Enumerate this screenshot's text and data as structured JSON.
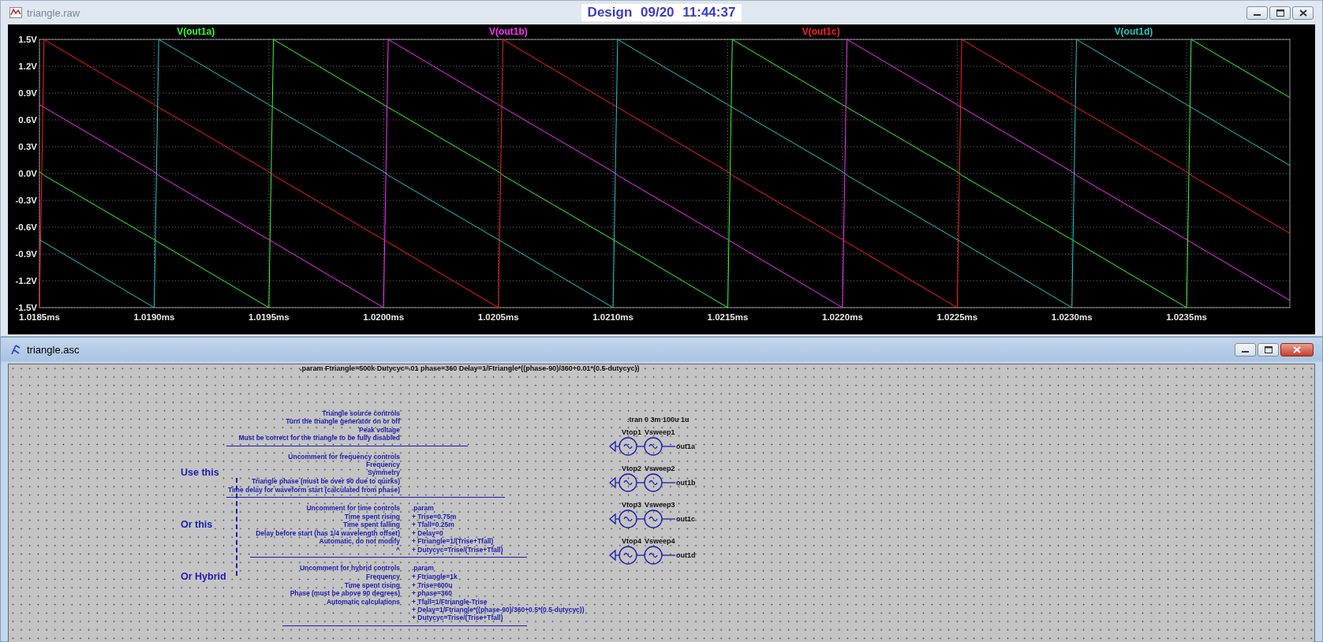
{
  "waveform_window": {
    "title": "triangle.raw",
    "plot_title": "Design 09/20 11:44:37",
    "chart_data": {
      "type": "line",
      "x": [
        1.0185,
        1.01852,
        1.019,
        1.01902,
        1.0195,
        1.01952,
        1.02,
        1.02002,
        1.0205,
        1.02052,
        1.021,
        1.02102,
        1.0215,
        1.02152,
        1.022,
        1.02202,
        1.0225,
        1.02252,
        1.023,
        1.02302,
        1.0235,
        1.02352,
        1.02395
      ],
      "series": [
        {
          "name": "V(out1a)",
          "color": "#33ff33",
          "values": [
            0.02,
            -0.02,
            -0.74,
            -0.77,
            -1.5,
            1.5,
            0.77,
            0.74,
            0.02,
            -0.02,
            -0.74,
            -0.77,
            -1.5,
            1.5,
            0.77,
            0.74,
            0.02,
            -0.02,
            -0.74,
            -0.77,
            -1.5,
            1.5,
            0.85
          ]
        },
        {
          "name": "V(out1b)",
          "color": "#ff33ff",
          "values": [
            0.77,
            0.74,
            0.02,
            -0.02,
            -0.74,
            -0.77,
            -1.5,
            1.5,
            0.77,
            0.74,
            0.02,
            -0.02,
            -0.74,
            -0.77,
            -1.5,
            1.5,
            0.77,
            0.74,
            0.02,
            -0.02,
            -0.74,
            -0.77,
            -1.42
          ]
        },
        {
          "name": "V(out1c)",
          "color": "#ff2020",
          "values": [
            -1.5,
            1.5,
            0.77,
            0.74,
            0.02,
            -0.02,
            -0.74,
            -0.77,
            -1.5,
            1.5,
            0.77,
            0.74,
            0.02,
            -0.02,
            -0.74,
            -0.77,
            -1.5,
            1.5,
            0.77,
            0.74,
            0.02,
            -0.02,
            -0.67
          ]
        },
        {
          "name": "V(out1d)",
          "color": "#20c8c8",
          "values": [
            -0.74,
            -0.77,
            -1.5,
            1.5,
            0.77,
            0.74,
            0.02,
            -0.02,
            -0.74,
            -0.77,
            -1.5,
            1.5,
            0.77,
            0.74,
            0.02,
            -0.02,
            -0.74,
            -0.77,
            -1.5,
            1.5,
            0.77,
            0.74,
            0.09
          ]
        }
      ],
      "grid": true,
      "xlim": [
        1.0185,
        1.02395
      ],
      "ylim": [
        -1.5,
        1.5
      ],
      "xticks": [
        {
          "value": 1.0185,
          "label": "1.0185ms"
        },
        {
          "value": 1.019,
          "label": "1.0190ms"
        },
        {
          "value": 1.0195,
          "label": "1.0195ms"
        },
        {
          "value": 1.02,
          "label": "1.0200ms"
        },
        {
          "value": 1.0205,
          "label": "1.0205ms"
        },
        {
          "value": 1.021,
          "label": "1.0210ms"
        },
        {
          "value": 1.0215,
          "label": "1.0215ms"
        },
        {
          "value": 1.022,
          "label": "1.0220ms"
        },
        {
          "value": 1.0225,
          "label": "1.0225ms"
        },
        {
          "value": 1.023,
          "label": "1.0230ms"
        },
        {
          "value": 1.0235,
          "label": "1.0235ms"
        }
      ],
      "yticks": [
        {
          "value": 1.5,
          "label": "1.5V"
        },
        {
          "value": 1.2,
          "label": "1.2V"
        },
        {
          "value": 0.9,
          "label": "0.9V"
        },
        {
          "value": 0.6,
          "label": "0.6V"
        },
        {
          "value": 0.3,
          "label": "0.3V"
        },
        {
          "value": 0,
          "label": "0.0V"
        },
        {
          "value": -0.3,
          "label": "-0.3V"
        },
        {
          "value": -0.6,
          "label": "-0.6V"
        },
        {
          "value": -0.9,
          "label": "-0.9V"
        },
        {
          "value": -1.2,
          "label": "-1.2V"
        },
        {
          "value": -1.5,
          "label": "-1.5V"
        }
      ]
    }
  },
  "schematic_window": {
    "title": "triangle.asc",
    "top_directive": ".param Ftriangle=500k Dutycyc=.01 phase=360 Delay=1/Ftriangle*((phase-90)/360+0.01*(0.5-dutycyc))",
    "sections": [
      {
        "rows": [
          {
            "comment": "Triangle source controls"
          },
          {
            "comment": "Turn the triangle generator on or off"
          },
          {
            "comment": "Peak voltage"
          },
          {
            "comment": "Must be correct for the triangle to be fully disabled"
          }
        ]
      },
      {
        "label": "Use this",
        "rows": [
          {
            "comment": "Uncomment for frequency controls"
          },
          {
            "comment": "Frequency"
          },
          {
            "comment": "Symmetry"
          },
          {
            "comment": "Triangle phase (must be over 90 due to quirks)"
          },
          {
            "comment": "Time delay for waveform start (calculated from phase)"
          }
        ]
      },
      {
        "label": "Or this",
        "rows": [
          {
            "comment": "Uncomment for time controls",
            "code": ".param"
          },
          {
            "comment": "Time spent rising",
            "code": "+ Trise=0.75m"
          },
          {
            "comment": "Time spent falling",
            "code": "+ Tfall=0.25m"
          },
          {
            "comment": "Delay before start (has 1/4 wavelength offset)",
            "code": "+ Delay=0"
          },
          {
            "comment": "Automatic, do not modify",
            "code": "+ Ftriangle=1/(Trise+Tfall)"
          },
          {
            "comment": "^",
            "code": "+ Dutycyc=Trise/(Trise+Tfall)"
          }
        ]
      },
      {
        "label": "Or Hybrid",
        "rows": [
          {
            "comment": "Uncomment for hybrid controls",
            "code": ".param"
          },
          {
            "comment": "Frequency",
            "code": "+ Ftriangle=1k"
          },
          {
            "comment": "Time spent rising",
            "code": "+ Trise=600u"
          },
          {
            "comment": "Phase (must be above 90 degrees)",
            "code": "+ phase=360"
          },
          {
            "comment": "Automatic calculations",
            "code": "+ Tfall=1/Ftriangle-Trise"
          },
          {
            "code": "+ Delay=1/Ftriangle*((phase-90)/360+0.5*(0.5-dutycyc))"
          },
          {
            "code": "+ Dutycyc=Trise/(Trise+Tfall)"
          }
        ]
      }
    ],
    "analysis_directive": ".tran 0 3m 100u 1u",
    "sources": [
      {
        "top": "Vtop1",
        "sweep": "Vsweep1",
        "net": "out1a"
      },
      {
        "top": "Vtop2",
        "sweep": "Vsweep2",
        "net": "out1b"
      },
      {
        "top": "Vtop3",
        "sweep": "Vsweep3",
        "net": "out1c"
      },
      {
        "top": "Vtop4",
        "sweep": "Vsweep4",
        "net": "out1d"
      }
    ]
  }
}
